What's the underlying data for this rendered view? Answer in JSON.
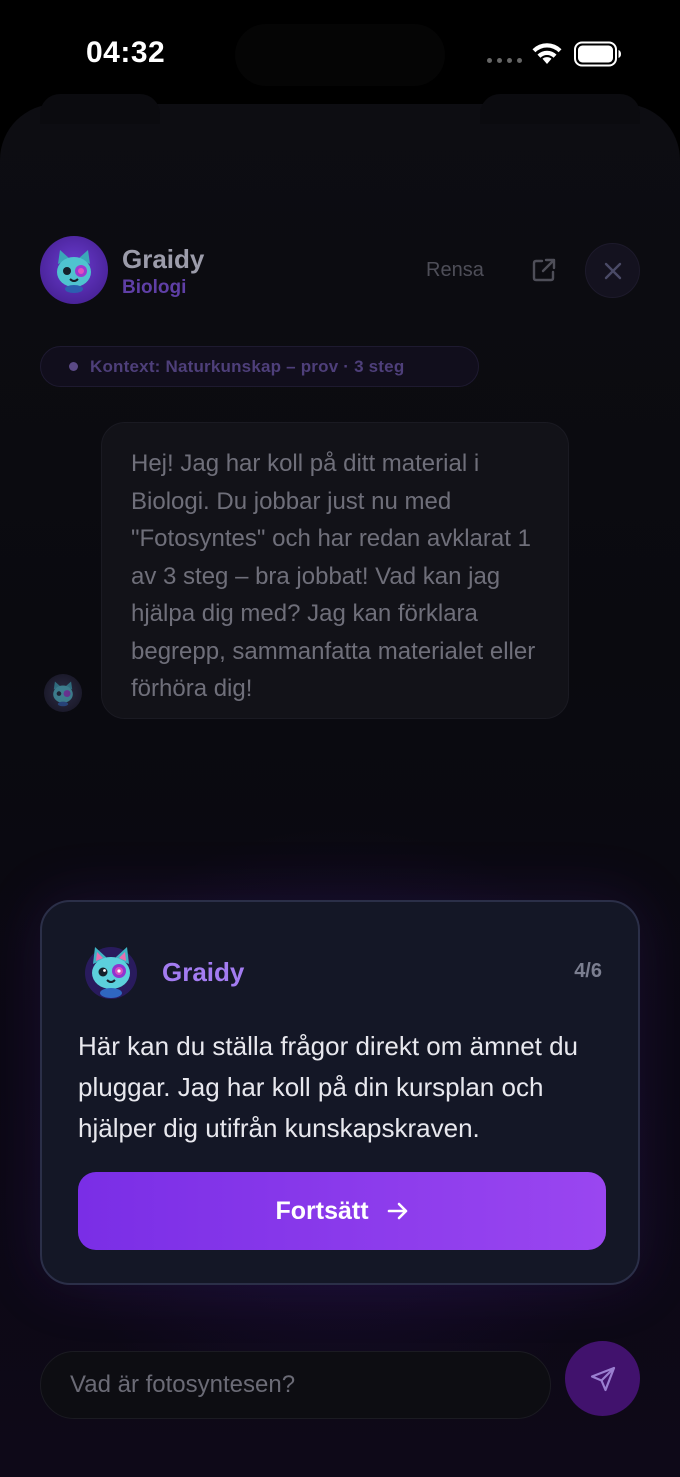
{
  "status_bar": {
    "time": "04:32"
  },
  "header": {
    "title": "Graidy",
    "subtitle": "Biologi",
    "clear_label": "Rensa"
  },
  "context": {
    "text": "Kontext: Naturkunskap – prov · 3 steg"
  },
  "message": {
    "text": "Hej! Jag har koll på ditt material i Biologi. Du jobbar just nu med \"Fotosyntes\" och har redan avklarat 1 av 3 steg – bra jobbat! Vad kan jag hjälpa dig med? Jag kan förklara begrepp, sammanfatta materialet eller förhöra dig!"
  },
  "tour": {
    "name": "Graidy",
    "step": "4/6",
    "text": "Här kan du ställa frågor direkt om ämnet du pluggar. Jag har koll på din kursplan och hjälper dig utifrån kunskapskraven.",
    "button_label": "Fortsätt"
  },
  "composer": {
    "value": "Vad är fotosyntesen?"
  },
  "colors": {
    "accent": "#9a46f0",
    "accent_dark": "#7a2ee6",
    "name_color": "#a37cf1"
  }
}
